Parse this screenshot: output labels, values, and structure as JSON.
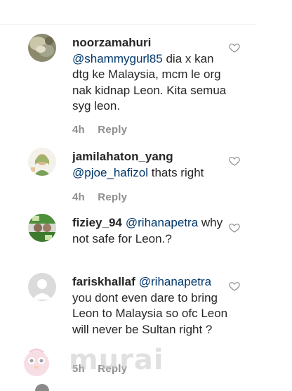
{
  "comments": [
    {
      "username": "noorzamahuri",
      "mention": "@shammygurl85",
      "text": " dia x kan dtg ke Malaysia, mcm le org nak kidnap Leon. Kita semua syg leon.",
      "time": "4h",
      "reply_label": "Reply",
      "avatar_icon": "avatar-photo"
    },
    {
      "username": "jamilahaton_yang",
      "mention": "@pjoe_hafizol",
      "text": " thats right",
      "time": "4h",
      "reply_label": "Reply",
      "avatar_icon": "avatar-photo"
    },
    {
      "username": "fiziey_94",
      "mention": "@rihanapetra",
      "text": " why not safe for Leon.?",
      "avatar_icon": "avatar-photo"
    },
    {
      "username": "fariskhallaf",
      "mention": "@rihanapetra",
      "text": " you dont even dare to bring Leon to Malaysia so ofc Leon will never be Sultan right ?",
      "time": "5h",
      "reply_label": "Reply",
      "avatar_icon": "default-avatar"
    }
  ],
  "watermark": {
    "text": "murai"
  },
  "colors": {
    "mention": "#00376b",
    "meta": "#8e8e8e",
    "text": "#262626"
  }
}
